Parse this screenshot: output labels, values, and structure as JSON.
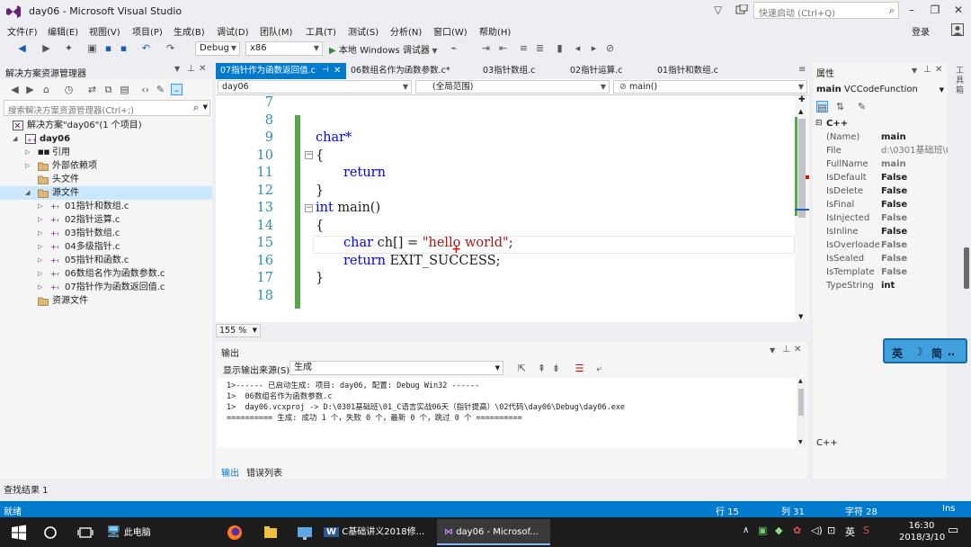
{
  "window": {
    "title": "day06 - Microsoft Visual Studio",
    "quick_launch_placeholder": "快速启动 (Ctrl+Q)",
    "login": "登录"
  },
  "menu": [
    "文件(F)",
    "编辑(E)",
    "视图(V)",
    "项目(P)",
    "生成(B)",
    "调试(D)",
    "团队(M)",
    "工具(T)",
    "测试(S)",
    "分析(N)",
    "窗口(W)",
    "帮助(H)"
  ],
  "toolbar": {
    "config": "Debug",
    "platform": "x86",
    "run_label": "本地 Windows 调试器"
  },
  "solution_explorer": {
    "title": "解决方案资源管理器",
    "search_placeholder": "搜索解决方案资源管理器(Ctrl+;)",
    "nodes": [
      {
        "label": "解决方案\"day06\"(1 个项目)"
      },
      {
        "label": "day06"
      },
      {
        "label": "引用"
      },
      {
        "label": "外部依赖项"
      },
      {
        "label": "头文件"
      },
      {
        "label": "源文件"
      },
      {
        "label": "01指针和数组.c"
      },
      {
        "label": "02指针运算.c"
      },
      {
        "label": "03指针数组.c"
      },
      {
        "label": "04多级指针.c"
      },
      {
        "label": "05指针和函数.c"
      },
      {
        "label": "06数组名作为函数参数.c"
      },
      {
        "label": "07指针作为函数返回值.c"
      },
      {
        "label": "资源文件"
      }
    ]
  },
  "tabs": [
    "07指针作为函数返回值.c",
    "06数组名作为函数参数.c*",
    "03指针数组.c",
    "02指针运算.c",
    "01指针和数组.c"
  ],
  "navbar": {
    "project": "day06",
    "scope": "(全局范围)",
    "func": "main()"
  },
  "editor": {
    "lines": [
      "7",
      "8",
      "9",
      "10",
      "11",
      "12",
      "13",
      "14",
      "15",
      "16",
      "17",
      "18"
    ],
    "code": {
      "l9": "char*",
      "l10": "{",
      "l11": "return",
      "l12": "}",
      "l13_kw": "int",
      "l13_rest": " main()",
      "l14": "{",
      "l15_kw": "char",
      "l15_mid": " ch[] = ",
      "l15_str": "\"hello world\"",
      "l15_end": ";",
      "l16_kw": "return",
      "l16_rest": " EXIT_SUCCESS;",
      "l17": "}"
    },
    "zoom": "155 %"
  },
  "output": {
    "title": "输出",
    "source_label": "显示输出来源(S):",
    "source_value": "生成",
    "lines": [
      "1>------ 已启动生成: 项目: day06, 配置: Debug Win32 ------",
      "1>  06数组名作为函数参数.c",
      "1>  day06.vcxproj -> D:\\0301基础班\\01_C语言实战06天（指针提高）\\02代码\\day06\\Debug\\day06.exe",
      "========== 生成: 成功 1 个，失败 0 个，最新 0 个，跳过 0 个 =========="
    ],
    "tabs": [
      "输出",
      "错误列表"
    ]
  },
  "properties": {
    "title": "属性",
    "object_name": "main",
    "object_type": "VCCodeFunction",
    "category": "C++",
    "rows": [
      {
        "key": "(Name)",
        "value": "main"
      },
      {
        "key": "File",
        "value": "d:\\0301基础班\\0"
      },
      {
        "key": "FullName",
        "value": "main"
      },
      {
        "key": "IsDefault",
        "value": "False"
      },
      {
        "key": "IsDelete",
        "value": "False"
      },
      {
        "key": "IsFinal",
        "value": "False"
      },
      {
        "key": "IsInjected",
        "value": "False"
      },
      {
        "key": "IsInline",
        "value": "False"
      },
      {
        "key": "IsOverloade",
        "value": "False"
      },
      {
        "key": "IsSealed",
        "value": "False"
      },
      {
        "key": "IsTemplate",
        "value": "False"
      },
      {
        "key": "TypeString",
        "value": "int"
      }
    ],
    "description": "C++"
  },
  "ime": {
    "lang": "英",
    "label": "简"
  },
  "find_results": "查找结果 1",
  "status": {
    "ready": "就绪",
    "row": "行 15",
    "col": "列 31",
    "char": "字符 28",
    "mode": "Ins"
  },
  "taskbar": {
    "this_pc": "此电脑",
    "word_task": "C基础讲义2018修...",
    "vs_task": "day06 - Microsof...",
    "ime_lang": "英",
    "time": "16:30",
    "date": "2018/3/10"
  }
}
